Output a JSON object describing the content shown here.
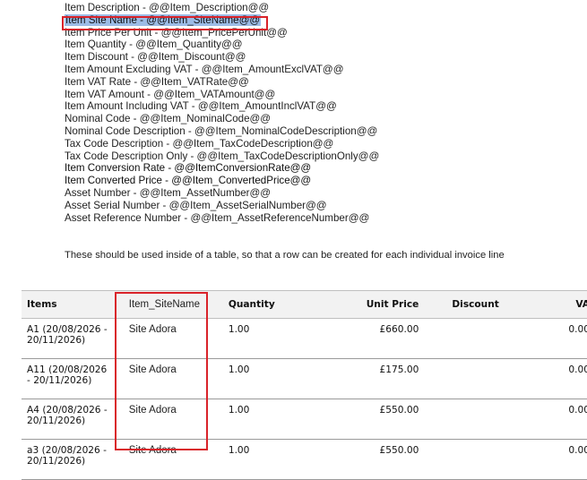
{
  "merge_fields": [
    "Item Description - @@Item_Description@@",
    "Item Site Name - @@Item_SiteName@@",
    "Item Price Per Unit - @@Item_PricePerUnit@@",
    "Item Quantity - @@Item_Quantity@@",
    "Item Discount - @@Item_Discount@@",
    "Item Amount Excluding VAT - @@Item_AmountExclVAT@@",
    "Item VAT Rate - @@Item_VATRate@@",
    "Item VAT Amount - @@Item_VATAmount@@",
    "Item Amount Including VAT - @@Item_AmountInclVAT@@",
    "Nominal Code - @@Item_NominalCode@@",
    "Nominal Code Description - @@Item_NominalCodeDescription@@",
    "Tax Code Description - @@Item_TaxCodeDescription@@",
    "Tax Code Description Only - @@Item_TaxCodeDescriptionOnly@@",
    "Item Conversion Rate - @@ItemConversionRate@@",
    "Item Converted Price - @@Item_ConvertedPrice@@",
    "Asset Number - @@Item_AssetNumber@@",
    "Asset Serial Number - @@Item_AssetSerialNumber@@",
    "Asset Reference Number - @@Item_AssetReferenceNumber@@"
  ],
  "note": "These should be used inside of a table, so that a row can be created for each individual invoice line",
  "table": {
    "headers": {
      "items": "Items",
      "site": "Item_SiteName",
      "quantity": "Quantity",
      "unit_price": "Unit Price",
      "discount": "Discount",
      "vat": "VA"
    },
    "rows": [
      {
        "item": "A1 (20/08/2026 - 20/11/2026)",
        "site": "Site Adora",
        "quantity": "1.00",
        "unit_price": "£660.00",
        "discount": "",
        "vat": "0.00"
      },
      {
        "item": "A11 (20/08/2026 - 20/11/2026)",
        "site": "Site Adora",
        "quantity": "1.00",
        "unit_price": "£175.00",
        "discount": "",
        "vat": "0.00"
      },
      {
        "item": "A4 (20/08/2026 - 20/11/2026)",
        "site": "Site Adora",
        "quantity": "1.00",
        "unit_price": "£550.00",
        "discount": "",
        "vat": "0.00"
      },
      {
        "item": "a3 (20/08/2026 - 20/11/2026)",
        "site": "Site Adora",
        "quantity": "1.00",
        "unit_price": "£550.00",
        "discount": "",
        "vat": "0.00"
      }
    ]
  },
  "colors": {
    "highlight": "#9cbce6",
    "annotation_red": "#d9232a",
    "header_bg": "#f2f2f2"
  }
}
